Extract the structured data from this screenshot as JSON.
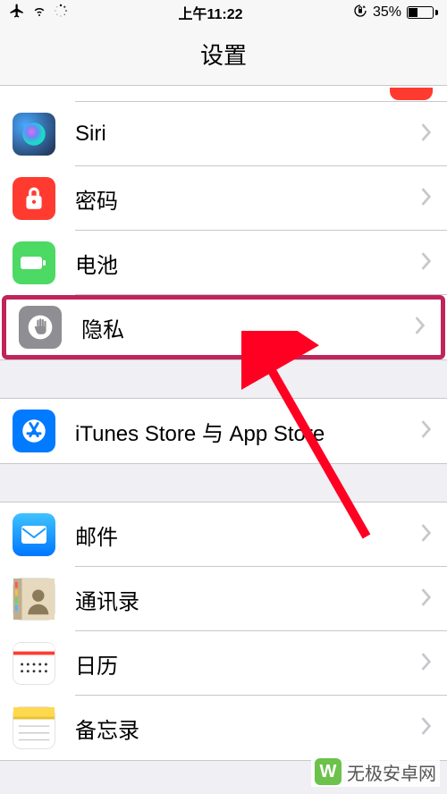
{
  "status": {
    "time": "上午11:22",
    "battery_pct": "35%"
  },
  "title": "设置",
  "rows": {
    "siri": "Siri",
    "password": "密码",
    "battery": "电池",
    "privacy": "隐私",
    "itunes": "iTunes Store 与 App Store",
    "mail": "邮件",
    "contacts": "通讯录",
    "calendar": "日历",
    "notes": "备忘录"
  },
  "watermark": "无极安卓网"
}
